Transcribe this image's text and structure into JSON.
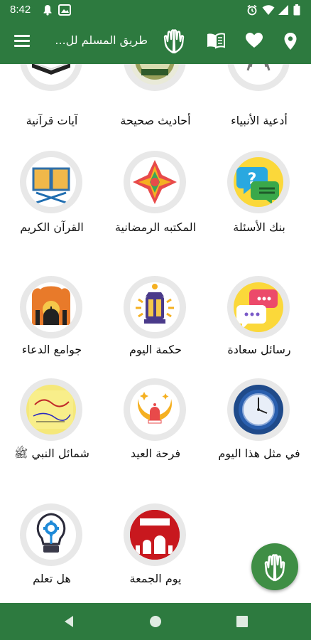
{
  "status_bar": {
    "time": "8:42"
  },
  "app_bar": {
    "title": "طريق المسلم لل..."
  },
  "tiles": [
    {
      "label": "أدعية الأنبياء",
      "icon": "praying-hands-icon"
    },
    {
      "label": "أحاديث صحيحة",
      "icon": "hadith-badge-icon"
    },
    {
      "label": "آيات قرآنية",
      "icon": "open-quran-book-icon"
    },
    {
      "label": "بنك الأسئلة",
      "icon": "question-chat-icon"
    },
    {
      "label": "المكتبه الرمضانية",
      "icon": "star-flower-icon"
    },
    {
      "label": "القرآن الكريم",
      "icon": "quran-on-stand-icon"
    },
    {
      "label": "رسائل  سعادة",
      "icon": "message-bubbles-icon"
    },
    {
      "label": "حكمة اليوم",
      "icon": "lantern-icon"
    },
    {
      "label": "جوامع الدعاء",
      "icon": "mosque-sunset-icon"
    },
    {
      "label": "في مثل هذا اليوم",
      "icon": "pocket-watch-icon"
    },
    {
      "label": "فرحة العيد",
      "icon": "crescent-mosque-icon"
    },
    {
      "label": "شمائل النبي ﷺ",
      "icon": "calligraphy-card-icon"
    },
    {
      "label": "يوم الجمعة",
      "icon": "friday-card-icon"
    },
    {
      "label": "هل تعلم",
      "icon": "lightbulb-icon"
    }
  ],
  "icons": {
    "menu": "hamburger-menu-icon",
    "logo": "praying-hands-logo-icon",
    "book": "book-icon",
    "heart": "heart-icon",
    "location": "location-pin-icon",
    "fab": "praying-hands-icon"
  },
  "colors": {
    "primary": "#2d7a3f",
    "fab": "#3f8e45",
    "tile_ring": "#e8e8e8"
  }
}
